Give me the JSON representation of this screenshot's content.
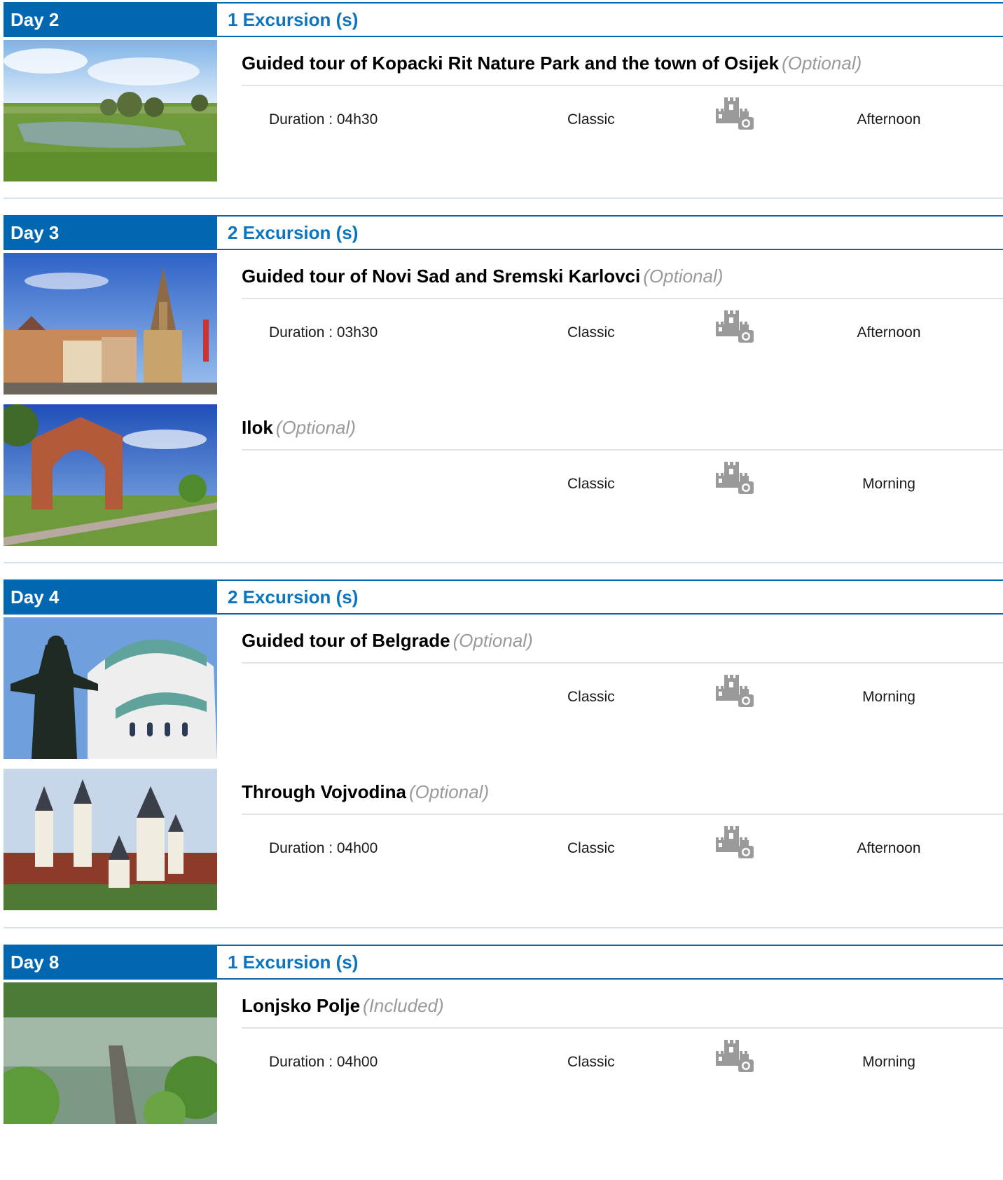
{
  "labels": {
    "duration_prefix": "Duration :"
  },
  "colors": {
    "accent": "#0167b1",
    "accent_text": "#0d74bf",
    "status_grey": "#9a9a9a"
  },
  "days": [
    {
      "label": "Day 2",
      "count_label": "1 Excursion (s)",
      "excursions": [
        {
          "title": "Guided tour of Kopacki Rit Nature Park and the town of Osijek",
          "status": "(Optional)",
          "duration": "Duration : 04h30",
          "level": "Classic",
          "time_of_day": "Afternoon",
          "type_icon": "castle-camera-icon",
          "thumb": "wetland-photo"
        }
      ]
    },
    {
      "label": "Day 3",
      "count_label": "2 Excursion (s)",
      "excursions": [
        {
          "title": "Guided tour of Novi Sad and Sremski Karlovci",
          "status": "(Optional)",
          "duration": "Duration : 03h30",
          "level": "Classic",
          "time_of_day": "Afternoon",
          "type_icon": "castle-camera-icon",
          "thumb": "cathedral-square-photo"
        },
        {
          "title": "Ilok",
          "status": "(Optional)",
          "duration": "",
          "level": "Classic",
          "time_of_day": "Morning",
          "type_icon": "castle-camera-icon",
          "thumb": "brick-arch-photo"
        }
      ]
    },
    {
      "label": "Day 4",
      "count_label": "2 Excursion (s)",
      "excursions": [
        {
          "title": "Guided tour of Belgrade",
          "status": "(Optional)",
          "duration": "",
          "level": "Classic",
          "time_of_day": "Morning",
          "type_icon": "castle-camera-icon",
          "thumb": "temple-statue-photo"
        },
        {
          "title": "Through Vojvodina",
          "status": "(Optional)",
          "duration": "Duration : 04h00",
          "level": "Classic",
          "time_of_day": "Afternoon",
          "type_icon": "castle-camera-icon",
          "thumb": "church-towers-photo"
        }
      ]
    },
    {
      "label": "Day 8",
      "count_label": "1 Excursion (s)",
      "excursions": [
        {
          "title": "Lonjsko Polje",
          "status": "(Included)",
          "duration": "Duration : 04h00",
          "level": "Classic",
          "time_of_day": "Morning",
          "type_icon": "castle-camera-icon",
          "thumb": "river-pier-photo"
        }
      ]
    }
  ]
}
